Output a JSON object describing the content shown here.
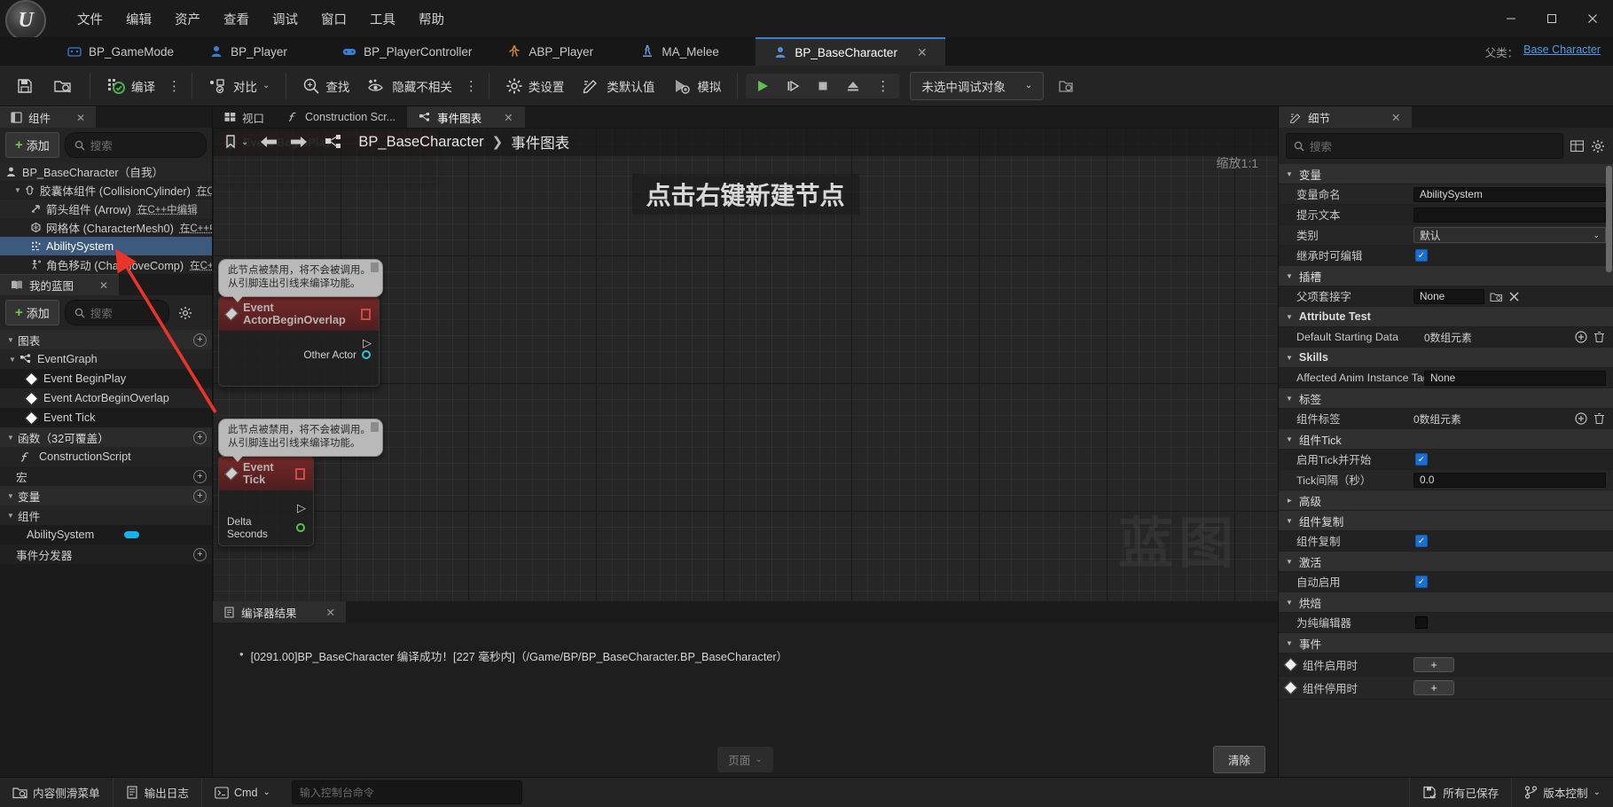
{
  "window": {
    "logo": "unreal-engine-logo",
    "menus": [
      "文件",
      "编辑",
      "资产",
      "查看",
      "调试",
      "窗口",
      "工具",
      "帮助"
    ],
    "controls": {
      "minimize": "—",
      "maximize": "▢",
      "close": "✕"
    }
  },
  "tabs": [
    {
      "label": "BP_GameMode",
      "icon": "gamemode-icon",
      "active": false
    },
    {
      "label": "BP_Player",
      "icon": "character-icon",
      "active": false
    },
    {
      "label": "BP_PlayerController",
      "icon": "controller-icon",
      "active": false
    },
    {
      "label": "ABP_Player",
      "icon": "animblueprint-icon",
      "active": false
    },
    {
      "label": "MA_Melee",
      "icon": "montage-icon",
      "active": false
    },
    {
      "label": "BP_BaseCharacter",
      "icon": "character-icon",
      "active": true,
      "close": "✕"
    }
  ],
  "header_right": {
    "parent_label": "父类：",
    "parent_value": "Base Character"
  },
  "toolbar": {
    "save": "保存",
    "browse": "在内容浏览器中浏览",
    "compile": "编译",
    "diff": "对比",
    "find": "查找",
    "hide_unrelated": "隐藏不相关",
    "class_settings": "类设置",
    "class_defaults": "类默认值",
    "simulate": "模拟",
    "play": "播放",
    "step": "步进",
    "stop": "停止",
    "eject": "弹出",
    "more": "⋮",
    "debug_object": "未选中调试对象"
  },
  "components_panel": {
    "tab_title": "组件",
    "tab_close": "✕",
    "add_label": "添加",
    "search_placeholder": "搜索",
    "tree": [
      {
        "label": "BP_BaseCharacter（自我）",
        "indent": 0,
        "icon": "character-icon",
        "cpp": "",
        "selected": false,
        "caret": ""
      },
      {
        "label": "胶囊体组件 (CollisionCylinder)",
        "indent": 1,
        "icon": "capsule-icon",
        "cpp": "在C++中编辑",
        "selected": false,
        "caret": "▼"
      },
      {
        "label": "箭头组件 (Arrow)",
        "indent": 2,
        "icon": "arrow-icon",
        "cpp": "在C++中编辑",
        "selected": false,
        "caret": ""
      },
      {
        "label": "网格体 (CharacterMesh0)",
        "indent": 2,
        "icon": "mesh-icon",
        "cpp": "在C++中编辑",
        "selected": false,
        "caret": ""
      },
      {
        "label": "AbilitySystem",
        "indent": 2,
        "icon": "abilitysystem-icon",
        "cpp": "",
        "selected": true,
        "caret": ""
      },
      {
        "label": "角色移动 (CharMoveComp)",
        "indent": 2,
        "icon": "charmove-icon",
        "cpp": "在C++中编辑",
        "selected": false,
        "caret": ""
      }
    ]
  },
  "myblueprint_panel": {
    "tab_title": "我的蓝图",
    "tab_close": "✕",
    "add_label": "添加",
    "search_placeholder": "搜索",
    "settings_icon": "gear-icon",
    "sections": [
      {
        "type": "header",
        "label": "图表",
        "has_plus": true
      },
      {
        "type": "item",
        "label": "EventGraph",
        "icon": "eventgraph-icon",
        "indent": 1,
        "caret": "▼"
      },
      {
        "type": "item",
        "label": "Event BeginPlay",
        "icon": "event-icon",
        "indent": 2
      },
      {
        "type": "item",
        "label": "Event ActorBeginOverlap",
        "icon": "event-icon",
        "indent": 2
      },
      {
        "type": "item",
        "label": "Event Tick",
        "icon": "event-icon",
        "indent": 2
      },
      {
        "type": "header",
        "label": "函数（32可覆盖）",
        "has_plus": true
      },
      {
        "type": "item",
        "label": "ConstructionScript",
        "icon": "function-icon",
        "indent": 1
      },
      {
        "type": "header_plain",
        "label": "宏",
        "has_plus": true
      },
      {
        "type": "header",
        "label": "变量",
        "has_plus": true
      },
      {
        "type": "header",
        "label": "组件",
        "has_plus": false
      },
      {
        "type": "item_var",
        "label": "AbilitySystem",
        "indent": 1,
        "pill_color": "#15b2ec"
      },
      {
        "type": "header_plain",
        "label": "事件分发器",
        "has_plus": true
      }
    ]
  },
  "graph": {
    "tabs": [
      {
        "label": "视口",
        "icon": "viewport-icon",
        "active": false
      },
      {
        "label": "Construction Scr...",
        "icon": "function-icon",
        "active": false
      },
      {
        "label": "事件图表",
        "icon": "eventgraph-icon",
        "active": true,
        "close": "✕"
      }
    ],
    "breadcrumb_root": "BP_BaseCharacter",
    "breadcrumb_chevron": "❯",
    "breadcrumb_leaf": "事件图表",
    "zoom_label": "缩放1:1",
    "hint": "点击右键新建节点",
    "watermark": "蓝图",
    "nav_back": "←",
    "nav_forward": "→",
    "nodes": [
      {
        "id": "node-beginplay",
        "title": "Event BeginPlay",
        "ghost": true,
        "tooltip": ""
      },
      {
        "id": "node-actorbeginoverlap",
        "title": "Event ActorBeginOverlap",
        "tooltip": "此节点被禁用，将不会被调用。\n从引脚连出引线来编译功能。",
        "tooltip_line1": "此节点被禁用，将不会被调用。",
        "tooltip_line2": "从引脚连出引线来编译功能。",
        "pins": [
          {
            "label": "Other Actor",
            "type": "object"
          }
        ]
      },
      {
        "id": "node-eventtick",
        "title": "Event Tick",
        "tooltip_line1": "此节点被禁用，将不会被调用。",
        "tooltip_line2": "从引脚连出引线来编译功能。",
        "pins": [
          {
            "label": "Delta Seconds",
            "type": "float"
          }
        ]
      }
    ]
  },
  "compiler_results": {
    "tab_title": "编译器结果",
    "tab_close": "✕",
    "messages": [
      "[0291.00]BP_BaseCharacter 编译成功！[227 毫秒内]（/Game/BP/BP_BaseCharacter.BP_BaseCharacter）"
    ],
    "page_label": "页面",
    "clear_label": "清除"
  },
  "details_panel": {
    "tab_title": "细节",
    "tab_close": "✕",
    "search_placeholder": "搜索",
    "grid_icon": "grid-view-icon",
    "settings_icon": "gear-icon",
    "rows": [
      {
        "kind": "category",
        "label": "变量"
      },
      {
        "kind": "prop",
        "label": "变量命名",
        "control": "text",
        "value": "AbilitySystem"
      },
      {
        "kind": "prop",
        "label": "提示文本",
        "control": "text",
        "value": ""
      },
      {
        "kind": "prop",
        "label": "类别",
        "control": "select",
        "value": "默认"
      },
      {
        "kind": "prop",
        "label": "继承时可编辑",
        "control": "checkbox",
        "value": true
      },
      {
        "kind": "category",
        "label": "插槽"
      },
      {
        "kind": "prop",
        "label": "父项套接字",
        "control": "text-pickers",
        "value": "None"
      },
      {
        "kind": "category",
        "label": "Attribute Test",
        "bold": true
      },
      {
        "kind": "prop",
        "label": "Default Starting Data",
        "control": "array",
        "value": "0数组元素"
      },
      {
        "kind": "category",
        "label": "Skills",
        "bold": true
      },
      {
        "kind": "prop",
        "label": "Affected Anim Instance Tag",
        "control": "text",
        "value": "None"
      },
      {
        "kind": "category",
        "label": "标签"
      },
      {
        "kind": "prop",
        "label": "组件标签",
        "control": "array",
        "value": "0数组元素"
      },
      {
        "kind": "category",
        "label": "组件Tick"
      },
      {
        "kind": "prop",
        "label": "启用Tick并开始",
        "control": "checkbox",
        "value": true
      },
      {
        "kind": "prop",
        "label": "Tick间隔（秒）",
        "control": "text",
        "value": "0.0"
      },
      {
        "kind": "category_collapsed",
        "label": "高级"
      },
      {
        "kind": "category",
        "label": "组件复制"
      },
      {
        "kind": "prop",
        "label": "组件复制",
        "control": "checkbox",
        "value": true
      },
      {
        "kind": "category",
        "label": "激活"
      },
      {
        "kind": "prop",
        "label": "自动启用",
        "control": "checkbox",
        "value": true
      },
      {
        "kind": "category",
        "label": "烘焙"
      },
      {
        "kind": "prop",
        "label": "为纯编辑器",
        "control": "checkbox-off",
        "value": false
      },
      {
        "kind": "category",
        "label": "事件"
      },
      {
        "kind": "event",
        "label": "组件启用时",
        "button": "+"
      },
      {
        "kind": "event",
        "label": "组件停用时",
        "button": "+"
      }
    ]
  },
  "statusbar": {
    "content_drawer": "内容侧滑菜单",
    "output_log": "输出日志",
    "cmd_label": "Cmd",
    "cmd_placeholder": "输入控制台命令",
    "saved": "所有已保存",
    "source_control": "版本控制"
  },
  "colors": {
    "accent_blue": "#1a6fd4",
    "selection_blue": "#3b5a7d",
    "green": "#7ac74f",
    "node_red": "#802a2a",
    "arrow_red": "#e03030",
    "link_blue": "#4c9be8"
  }
}
